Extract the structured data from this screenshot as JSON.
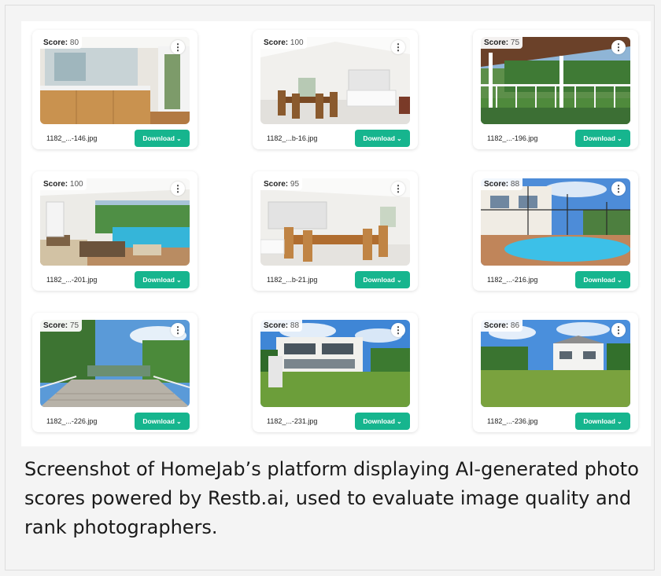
{
  "score_label": "Score:",
  "download_label": "Download",
  "menu_glyph": "⋮",
  "chevron_glyph": "⌄",
  "accent_color": "#16b58e",
  "cards": [
    {
      "score": "80",
      "filename": "1182_...-146.jpg",
      "scene": "bathroom"
    },
    {
      "score": "100",
      "filename": "1182_...b-16.jpg",
      "scene": "dining-room"
    },
    {
      "score": "75",
      "filename": "1182_...-196.jpg",
      "scene": "lanai"
    },
    {
      "score": "100",
      "filename": "1182_...-201.jpg",
      "scene": "pool-patio"
    },
    {
      "score": "95",
      "filename": "1182_...b-21.jpg",
      "scene": "dining-room"
    },
    {
      "score": "88",
      "filename": "1182_...-216.jpg",
      "scene": "pool-exterior"
    },
    {
      "score": "75",
      "filename": "1182_...-226.jpg",
      "scene": "dock"
    },
    {
      "score": "88",
      "filename": "1182_...-231.jpg",
      "scene": "house-rear"
    },
    {
      "score": "86",
      "filename": "1182_...-236.jpg",
      "scene": "house-yard"
    }
  ],
  "caption": "Screenshot of HomeJab’s platform displaying AI-generated photo scores powered by Restb.ai, used to evaluate image quality and rank photographers."
}
